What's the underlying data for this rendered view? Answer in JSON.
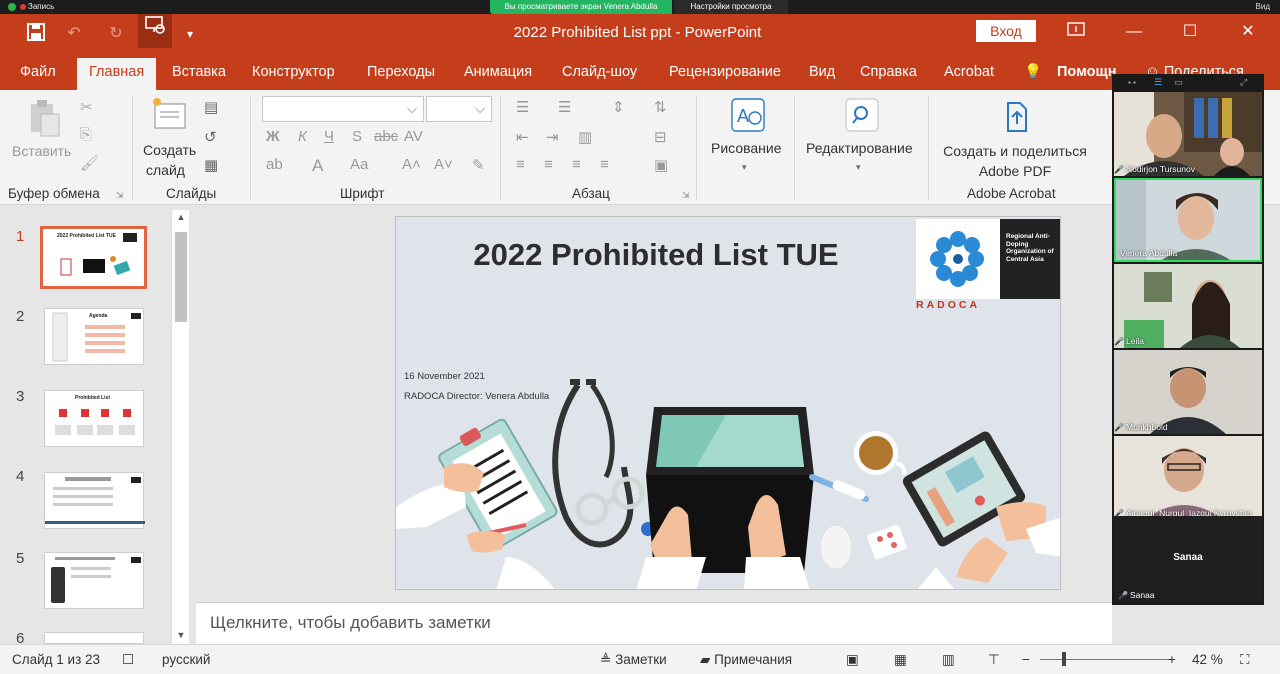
{
  "zoom_bar": {
    "recording": "Запись",
    "sharing_notice": "Вы просматриваете экран Venera Abdulla",
    "view_options": "Настройки просмотра",
    "view": "Вид"
  },
  "titlebar": {
    "document_title": "2022 Prohibited List ppt  -  PowerPoint",
    "login_label": "Вход"
  },
  "tabs": [
    {
      "label": "Файл"
    },
    {
      "label": "Главная"
    },
    {
      "label": "Вставка"
    },
    {
      "label": "Конструктор"
    },
    {
      "label": "Переходы"
    },
    {
      "label": "Анимация"
    },
    {
      "label": "Слайд-шоу"
    },
    {
      "label": "Рецензирование"
    },
    {
      "label": "Вид"
    },
    {
      "label": "Справка"
    },
    {
      "label": "Acrobat"
    },
    {
      "label": "Помощн"
    },
    {
      "label": "Поделиться"
    }
  ],
  "ribbon": {
    "clipboard": {
      "paste": "Вставить",
      "label": "Буфер обмена"
    },
    "slides": {
      "new_slide": "Создать",
      "new_slide2": "слайд",
      "label": "Слайды"
    },
    "font": {
      "label": "Шрифт",
      "bold": "Ж",
      "italic": "К",
      "underline": "Ч",
      "strike": "abc"
    },
    "paragraph": {
      "label": "Абзац"
    },
    "drawing": {
      "label": "Рисование"
    },
    "editing": {
      "label": "Редактирование"
    },
    "acrobat": {
      "line1": "Создать и поделиться",
      "line2": "Adobe PDF",
      "label": "Adobe Acrobat"
    }
  },
  "slides_pane": {
    "thumbs": [
      {
        "num": "1",
        "title": "2022 Prohibited List TUE"
      },
      {
        "num": "2",
        "title": "Agenda"
      },
      {
        "num": "3",
        "title": "Prohibited List"
      },
      {
        "num": "4",
        "title": ""
      },
      {
        "num": "5",
        "title": ""
      },
      {
        "num": "6",
        "title": ""
      }
    ]
  },
  "slide": {
    "title": "2022 Prohibited List TUE",
    "date": "16 November 2021",
    "director": "RADOCA Director: Venera Abdulla",
    "logo_text": "Regional Anti-Doping Organization of Central Asia",
    "logo_name": "RADOCA"
  },
  "notes": {
    "placeholder": "Щелкните, чтобы добавить заметки"
  },
  "participants": [
    {
      "name": "Nodirjon Tursunov"
    },
    {
      "name": "Venera Abdulla"
    },
    {
      "name": "Leila"
    },
    {
      "name": "Munkhbold"
    },
    {
      "name": "Ainagul_Nurgul_Iazgul Kyrgystan"
    },
    {
      "name": "Sanaa"
    }
  ],
  "status": {
    "slide_counter": "Слайд 1 из 23",
    "language": "русский",
    "notes": "Заметки",
    "comments": "Примечания",
    "zoom": "42 %"
  },
  "colors": {
    "accent": "#c43e1c",
    "zoom_green": "#23b560"
  }
}
